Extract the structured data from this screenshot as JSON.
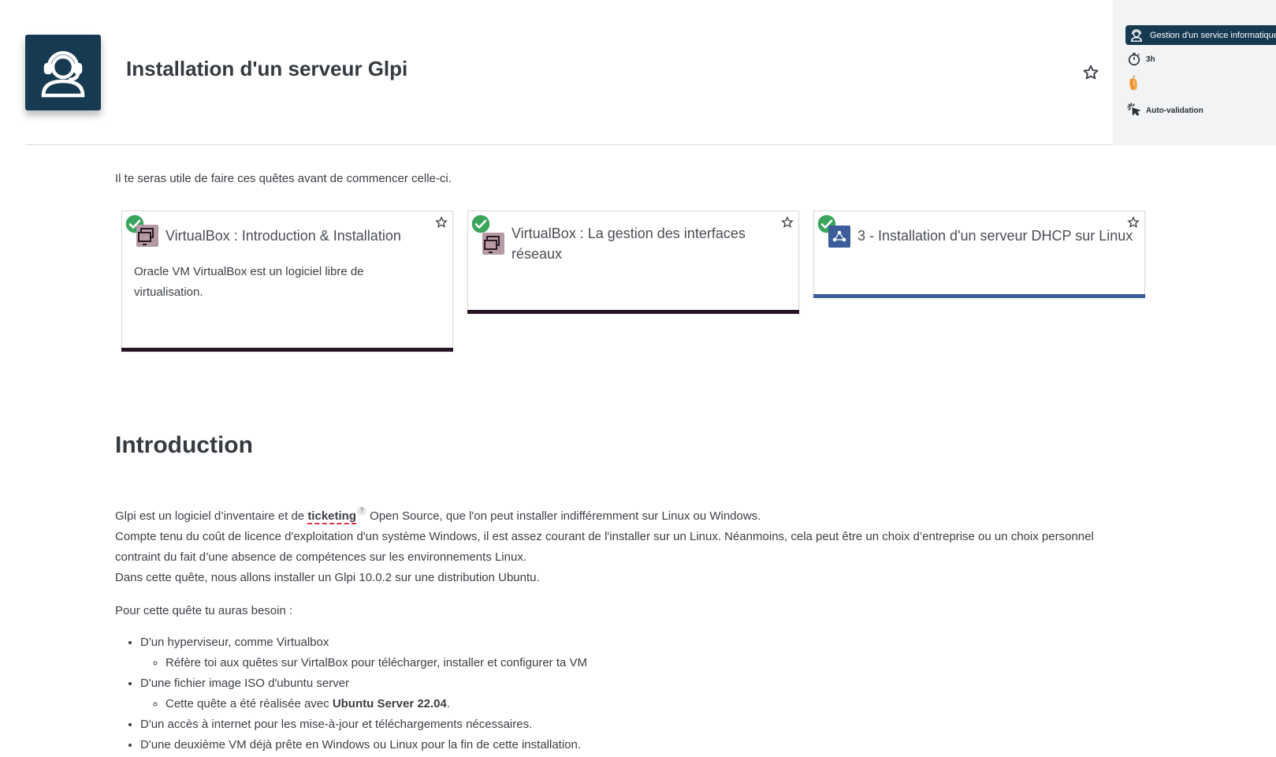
{
  "header": {
    "title": "Installation d'un serveur Glpi"
  },
  "side_panel": {
    "category": "Gestion d'un service informatique",
    "duration": "3h",
    "validation": "Auto-validation",
    "colors": {
      "tag_bg": "#163a52",
      "badge": "#f0912a"
    }
  },
  "prerequisites": {
    "intro": "Il te seras utile de faire ces quêtes avant de commencer celle-ci.",
    "cards": [
      {
        "title": "VirtualBox : Introduction & Installation",
        "description": "Oracle VM VirtualBox est un logiciel libre de virtualisation.",
        "completed": true,
        "icon": "virtualbox-icon",
        "bar_color": "#261326"
      },
      {
        "title": "VirtualBox : La gestion des interfaces réseaux",
        "description": "",
        "completed": true,
        "icon": "virtualbox-icon",
        "bar_color": "#261326"
      },
      {
        "title": "3 - Installation d'un serveur DHCP sur Linux",
        "description": "",
        "completed": true,
        "icon": "network-icon",
        "bar_color": "#3b5e9a"
      }
    ]
  },
  "content": {
    "section_title": "Introduction",
    "p1_before": "Glpi est un logiciel d’inventaire et de ",
    "p1_term": "ticketing",
    "p1_term_hint": "?",
    "p1_after": " Open Source, que l'on peut installer indifféremment sur Linux ou Windows.",
    "p2": "Compte tenu du coût de licence d'exploitation d'un système Windows, il est assez courant de l'installer sur un Linux. Néanmoins, cela peut être un choix d’entreprise ou un choix personnel contraint du fait d’une absence de compétences sur les environnements Linux.",
    "p3": "Dans cette quête, nous allons installer un Glpi 10.0.2 sur une distribution Ubuntu.",
    "needs_intro": "Pour cette quête tu auras besoin :",
    "needs": {
      "hypervisor": "D'un hyperviseur, comme Virtualbox",
      "hypervisor_sub": "Réfère toi aux quêtes sur VirtalBox pour télécharger, installer et configurer ta VM",
      "iso": "D'une fichier image ISO d'ubuntu server",
      "iso_sub_before": "Cette quête a été réalisée avec ",
      "iso_sub_bold": "Ubuntu Server 22.04",
      "iso_sub_after": ".",
      "internet": "D'un accès à internet pour les mise-à-jour et téléchargements nécessaires.",
      "vm": "D'une deuxième VM déjà prête en Windows ou Linux pour la fin de cette installation."
    }
  }
}
